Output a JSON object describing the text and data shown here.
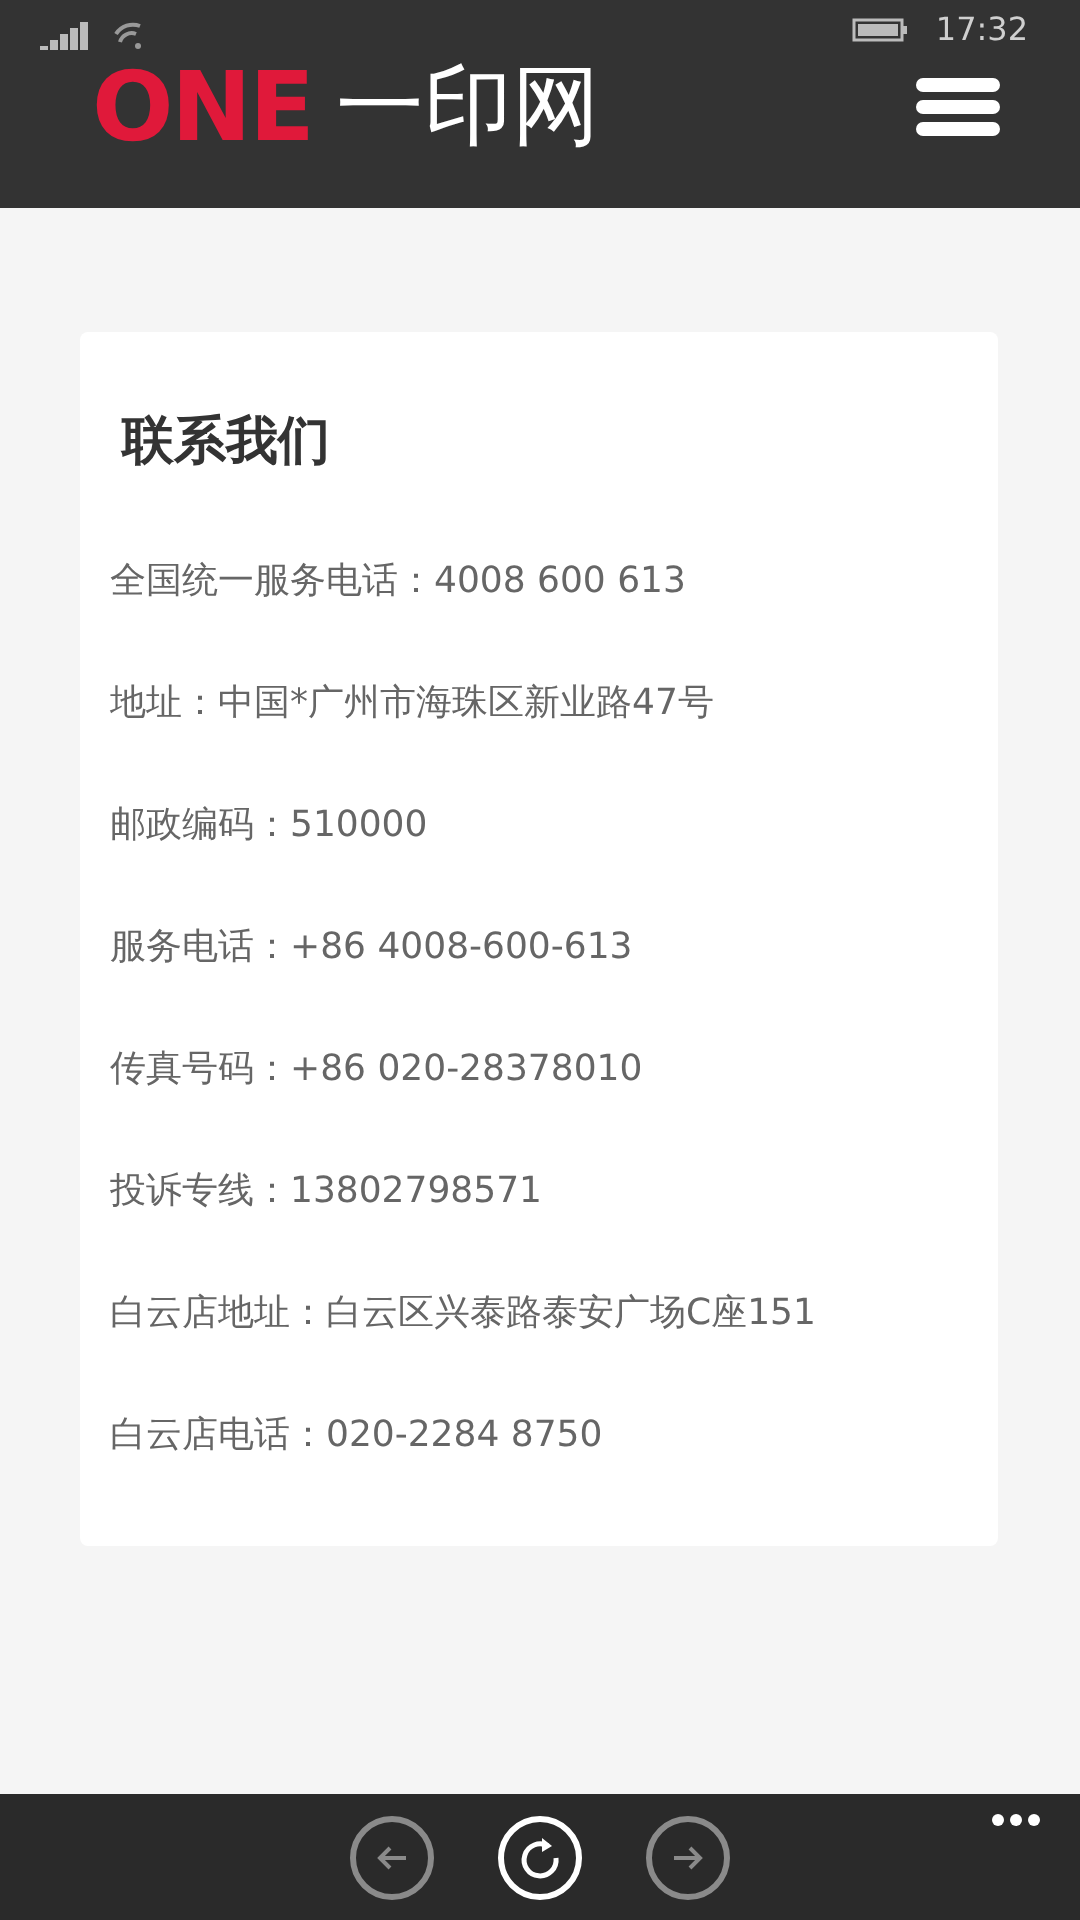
{
  "status_bar": {
    "time": "17:32"
  },
  "header": {
    "logo": {
      "brand": "ONE",
      "name": "一印网"
    }
  },
  "contact": {
    "title": "联系我们",
    "lines": [
      {
        "label": "全国统一服务电话：",
        "value": "4008 600 613"
      },
      {
        "label": "地址：",
        "value": "中国*广州市海珠区新业路47号"
      },
      {
        "label": "邮政编码：",
        "value": "510000"
      },
      {
        "label": "服务电话：",
        "value": "+86 4008-600-613"
      },
      {
        "label": "传真号码：",
        "value": "+86 020-28378010"
      },
      {
        "label": "投诉专线：",
        "value": "13802798571"
      },
      {
        "label": "白云店地址：",
        "value": "白云区兴泰路泰安广场C座151"
      },
      {
        "label": "白云店电话：",
        "value": "020-2284 8750"
      }
    ]
  },
  "browser_bar": {
    "back": {
      "disabled": true
    },
    "forward": {
      "disabled": true
    }
  }
}
